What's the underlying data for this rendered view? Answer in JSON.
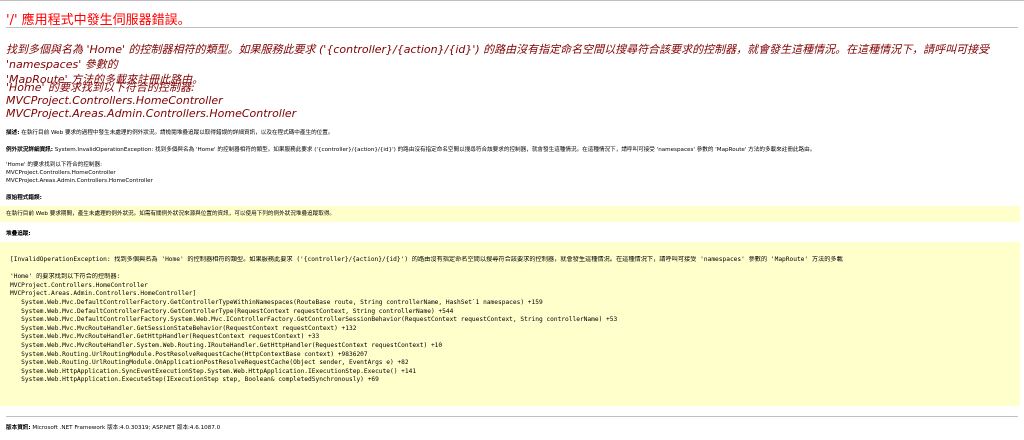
{
  "page_title": "'/' 應用程式中發生伺服器錯誤。",
  "summary": {
    "line1": "找到多個與名為 'Home' 的控制器相符的類型。如果服務此要求 ('{controller}/{action}/{id}') 的路由沒有指定命名空間以搜尋符合該要求的控制器，就會發生這種情況。在這種情況下，請呼叫可接受 'namespaces' 參數的",
    "line2": "'MapRoute' 方法的多載來註冊此路由。"
  },
  "matches": {
    "heading": "'Home' 的要求找到以下符合的控制器:",
    "items": [
      "MVCProject.Controllers.HomeController",
      "MVCProject.Areas.Admin.Controllers.HomeController"
    ]
  },
  "description": {
    "label": "描述:",
    "text": "在執行目前 Web 要求的過程中發生未處理的例外狀況。請檢閱堆疊追蹤以取得錯誤的詳細資訊，以及在程式碼中產生的位置。"
  },
  "exception_details": {
    "label": "例外狀況詳細資訊:",
    "text": "System.InvalidOperationException: 找到多個與名為 'Home' 的控制器相符的類型。如果服務此要求 ('{controller}/{action}/{id}') 的路由沒有指定命名空間以搜尋符合該要求的控制器，就會發生這種情況。在這種情況下，請呼叫可接受 'namespaces' 參數的 'MapRoute' 方法的多載來註冊此路由。"
  },
  "details_matches": {
    "heading": "'Home' 的要求找到以下符合的控制器:",
    "items": [
      "MVCProject.Controllers.HomeController",
      "MVCProject.Areas.Admin.Controllers.HomeController"
    ]
  },
  "source_error": {
    "label": "原始程式錯誤:",
    "text": "在執行目前 Web 要求期間，產生未處理的例外狀況。如需有關例外狀況來源與位置的資訊，可以使用下列的例外狀況堆疊追蹤取得。"
  },
  "stack_trace": {
    "label": "堆疊追蹤:",
    "lines": [
      "[InvalidOperationException: 找到多個與名為 'Home' 的控制器相符的類型。如果服務此要求 ('{controller}/{action}/{id}') 的路由沒有指定命名空間以搜尋符合該要求的控制器，就會發生這種情況。在這種情況下，請呼叫可接受 'namespaces' 參數的 'MapRoute' 方法的多載",
      "",
      "'Home' 的要求找到以下符合的控制器:",
      "MVCProject.Controllers.HomeController",
      "MVCProject.Areas.Admin.Controllers.HomeController]",
      "   System.Web.Mvc.DefaultControllerFactory.GetControllerTypeWithinNamespaces(RouteBase route, String controllerName, HashSet`1 namespaces) +159",
      "   System.Web.Mvc.DefaultControllerFactory.GetControllerType(RequestContext requestContext, String controllerName) +544",
      "   System.Web.Mvc.DefaultControllerFactory.System.Web.Mvc.IControllerFactory.GetControllerSessionBehavior(RequestContext requestContext, String controllerName) +53",
      "   System.Web.Mvc.MvcRouteHandler.GetSessionStateBehavior(RequestContext requestContext) +132",
      "   System.Web.Mvc.MvcRouteHandler.GetHttpHandler(RequestContext requestContext) +33",
      "   System.Web.Mvc.MvcRouteHandler.System.Web.Routing.IRouteHandler.GetHttpHandler(RequestContext requestContext) +10",
      "   System.Web.Routing.UrlRoutingModule.PostResolveRequestCache(HttpContextBase context) +9836207",
      "   System.Web.Routing.UrlRoutingModule.OnApplicationPostResolveRequestCache(Object sender, EventArgs e) +82",
      "   System.Web.HttpApplication.SyncEventExecutionStep.System.Web.HttpApplication.IExecutionStep.Execute() +141",
      "   System.Web.HttpApplication.ExecuteStep(IExecutionStep step, Boolean& completedSynchronously) +69"
    ]
  },
  "version_info": {
    "label": "版本資訊:",
    "text": "Microsoft .NET Framework 版本:4.0.30319; ASP.NET 版本:4.6.1087.0"
  },
  "colors": {
    "title_red": "#ff0000",
    "heading_maroon": "#800000",
    "box_yellow": "#ffffcc"
  }
}
